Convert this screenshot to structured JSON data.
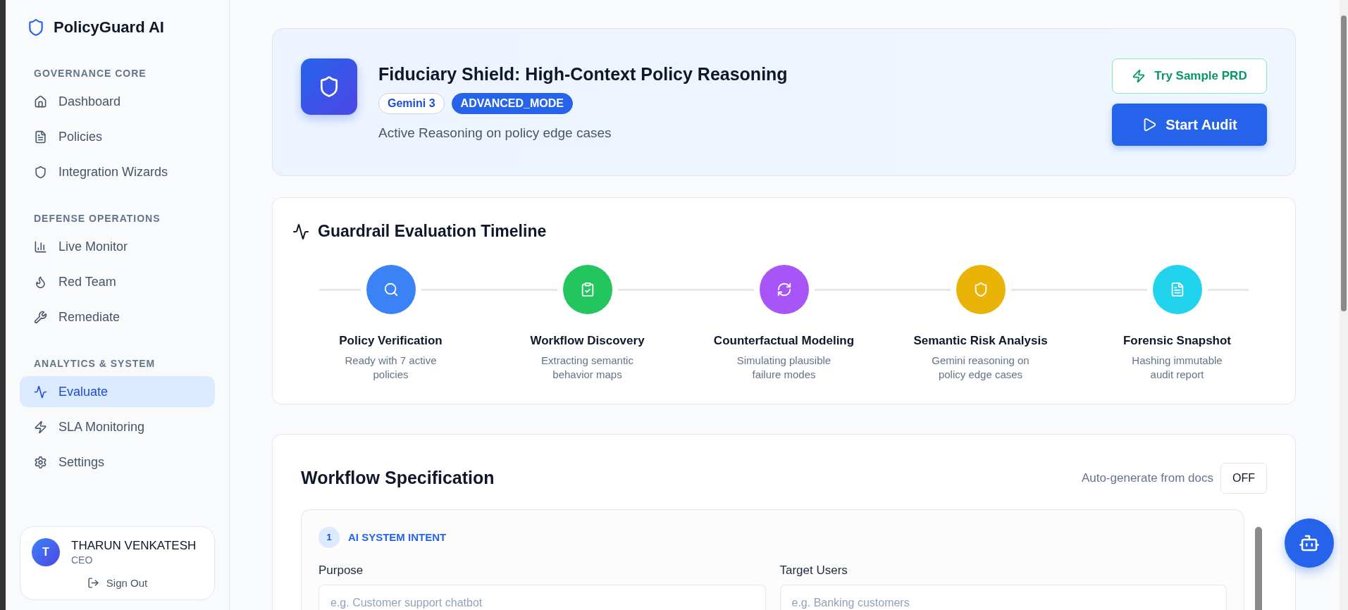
{
  "sidebar": {
    "brand": "PolicyGuard AI",
    "sections": [
      {
        "title": "GOVERNANCE CORE",
        "items": [
          {
            "label": "Dashboard",
            "kind": "home",
            "selected": false
          },
          {
            "label": "Policies",
            "kind": "file",
            "selected": false
          },
          {
            "label": "Integration Wizards",
            "kind": "shield",
            "selected": false
          }
        ]
      },
      {
        "title": "DEFENSE OPERATIONS",
        "items": [
          {
            "label": "Live Monitor",
            "kind": "chart",
            "selected": false
          },
          {
            "label": "Red Team",
            "kind": "flame",
            "selected": false
          },
          {
            "label": "Remediate",
            "kind": "wrench",
            "selected": false
          }
        ]
      },
      {
        "title": "ANALYTICS & SYSTEM",
        "items": [
          {
            "label": "Evaluate",
            "kind": "activity",
            "selected": true
          },
          {
            "label": "SLA Monitoring",
            "kind": "zap",
            "selected": false
          },
          {
            "label": "Settings",
            "kind": "gear",
            "selected": false
          }
        ]
      }
    ]
  },
  "user": {
    "initial": "T",
    "name": "THARUN VENKATESH",
    "role": "CEO",
    "sign_out": "Sign Out"
  },
  "hero": {
    "title": "Fiduciary Shield: High-Context Policy Reasoning",
    "badges": [
      {
        "label": "Gemini 3",
        "kind": "outline"
      },
      {
        "label": "ADVANCED_MODE",
        "kind": "solid"
      }
    ],
    "subtitle": "Active Reasoning on policy edge cases",
    "buttons": [
      {
        "label": "Try Sample PRD",
        "kind": "secondary"
      },
      {
        "label": "Start Audit",
        "kind": "primary"
      }
    ]
  },
  "timeline": {
    "title": "Guardrail Evaluation Timeline",
    "steps": [
      {
        "title": "Policy Verification",
        "description": "Ready with 7 active policies",
        "color": "#3b82f6",
        "kind": "search"
      },
      {
        "title": "Workflow Discovery",
        "description": "Extracting semantic behavior maps",
        "color": "#22c55e",
        "kind": "clipboard"
      },
      {
        "title": "Counterfactual Modeling",
        "description": "Simulating plausible failure modes",
        "color": "#a855f7",
        "kind": "refresh"
      },
      {
        "title": "Semantic Risk Analysis",
        "description": "Gemini reasoning on policy edge cases",
        "color": "#eab308",
        "kind": "shield"
      },
      {
        "title": "Forensic Snapshot",
        "description": "Hashing immutable audit report",
        "color": "#22d3ee",
        "kind": "file"
      }
    ]
  },
  "workflow": {
    "title": "Workflow Specification",
    "auto_label": "Auto-generate from docs",
    "toggle": "OFF",
    "section": {
      "number": "1",
      "title": "AI SYSTEM INTENT",
      "fields": [
        {
          "label": "Purpose",
          "placeholder": "e.g. Customer support chatbot"
        },
        {
          "label": "Target Users",
          "placeholder": "e.g. Banking customers"
        }
      ]
    }
  }
}
